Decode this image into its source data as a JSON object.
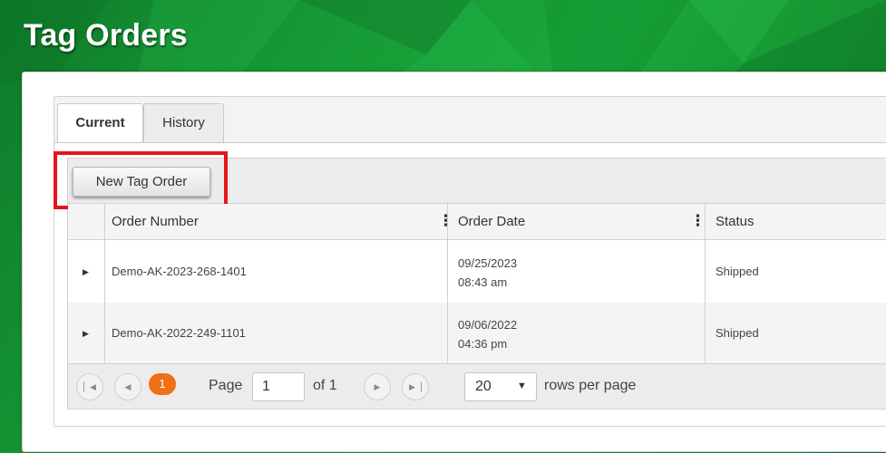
{
  "page": {
    "title": "Tag Orders"
  },
  "tabs": [
    {
      "label": "Current",
      "active": true
    },
    {
      "label": "History",
      "active": false
    }
  ],
  "toolbar": {
    "new_order_label": "New Tag Order"
  },
  "grid": {
    "columns": [
      "Order Number",
      "Order Date",
      "Status"
    ],
    "column_menu_glyph": "⋮",
    "rows": [
      {
        "order_number": "Demo-AK-2023-268-1401",
        "date": "09/25/2023",
        "time": "08:43 am",
        "status": "Shipped"
      },
      {
        "order_number": "Demo-AK-2022-249-1101",
        "date": "09/06/2022",
        "time": "04:36 pm",
        "status": "Shipped"
      }
    ]
  },
  "pager": {
    "current_page_badge": "1",
    "page_label": "Page",
    "page_value": "1",
    "of_label": "of 1",
    "page_size": "20",
    "rows_per_page_label": "rows per page"
  },
  "icons": {
    "first": "first-page-icon",
    "prev": "previous-page-icon",
    "next": "next-page-icon",
    "last": "last-page-icon",
    "expand": "expand-row-icon",
    "dropdown": "chevron-down-icon"
  },
  "colors": {
    "header_green": "#169a35",
    "highlight_red": "#e8141b",
    "page_badge_orange": "#f07018"
  }
}
